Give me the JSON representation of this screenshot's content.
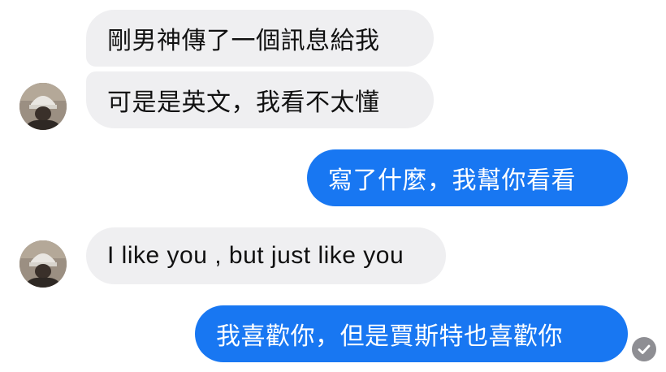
{
  "conversation": {
    "messages": [
      {
        "sender": "contact",
        "text": "剛男神傳了一個訊息給我"
      },
      {
        "sender": "contact",
        "text": "可是是英文，我看不太懂"
      },
      {
        "sender": "me",
        "text": "寫了什麼，我幫你看看"
      },
      {
        "sender": "contact",
        "text": "I like you , but just like you"
      },
      {
        "sender": "me",
        "text": "我喜歡你，但是賈斯特也喜歡你"
      }
    ],
    "read_receipt_icon": "check-circle-icon"
  },
  "colors": {
    "incoming_bubble": "#efeff1",
    "outgoing_bubble": "#1877f2",
    "read_receipt": "#8e8e93"
  }
}
